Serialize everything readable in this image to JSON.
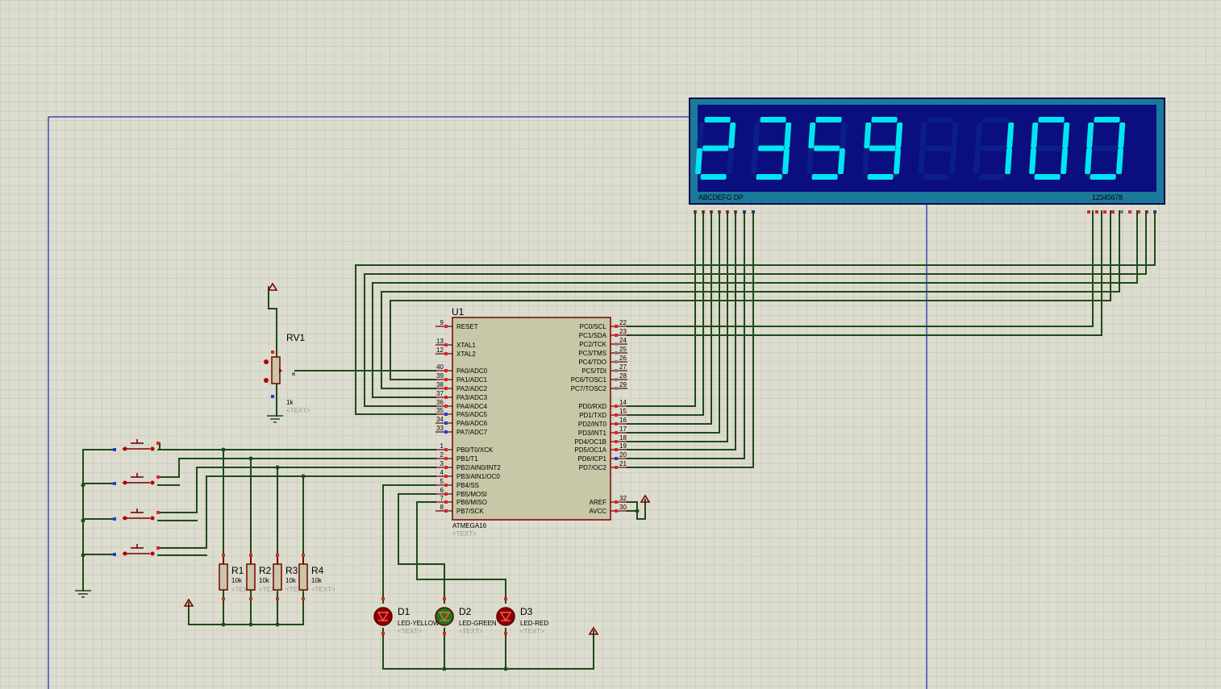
{
  "display": {
    "digits": [
      "2",
      "3",
      "5",
      "9",
      "8",
      "1",
      "0",
      "0"
    ],
    "lit": [
      true,
      true,
      true,
      true,
      false,
      true,
      true,
      true
    ],
    "segment_label": "ABCDEFG DP",
    "digit_label": "12345678",
    "lit_color": "#00e5f2",
    "dim_color": "#0a1d8a",
    "bg_color": "#0b0e7e",
    "frame_color": "#1b7a9c"
  },
  "mcu": {
    "ref": "U1",
    "part": "ATMEGA16",
    "text": "<TEXT>",
    "left_pins": [
      {
        "num": "9",
        "name": "RESET"
      },
      {
        "num": "13",
        "name": "XTAL1"
      },
      {
        "num": "12",
        "name": "XTAL2"
      },
      {
        "num": "40",
        "name": "PA0/ADC0"
      },
      {
        "num": "39",
        "name": "PA1/ADC1"
      },
      {
        "num": "38",
        "name": "PA2/ADC2"
      },
      {
        "num": "37",
        "name": "PA3/ADC3"
      },
      {
        "num": "36",
        "name": "PA4/ADC4"
      },
      {
        "num": "35",
        "name": "PA5/ADC5"
      },
      {
        "num": "34",
        "name": "PA6/ADC6"
      },
      {
        "num": "33",
        "name": "PA7/ADC7"
      },
      {
        "num": "1",
        "name": "PB0/T0/XCK"
      },
      {
        "num": "2",
        "name": "PB1/T1"
      },
      {
        "num": "3",
        "name": "PB2/AIN0/INT2"
      },
      {
        "num": "4",
        "name": "PB3/AIN1/OC0"
      },
      {
        "num": "5",
        "name": "PB4/SS"
      },
      {
        "num": "6",
        "name": "PB5/MOSI"
      },
      {
        "num": "7",
        "name": "PB6/MISO"
      },
      {
        "num": "8",
        "name": "PB7/SCK"
      }
    ],
    "right_pins": [
      {
        "num": "22",
        "name": "PC0/SCL"
      },
      {
        "num": "23",
        "name": "PC1/SDA"
      },
      {
        "num": "24",
        "name": "PC2/TCK"
      },
      {
        "num": "25",
        "name": "PC3/TMS"
      },
      {
        "num": "26",
        "name": "PC4/TDO"
      },
      {
        "num": "27",
        "name": "PC5/TDI"
      },
      {
        "num": "28",
        "name": "PC6/TOSC1"
      },
      {
        "num": "29",
        "name": "PC7/TOSC2"
      },
      {
        "num": "14",
        "name": "PD0/RXD"
      },
      {
        "num": "15",
        "name": "PD1/TXD"
      },
      {
        "num": "16",
        "name": "PD2/INT0"
      },
      {
        "num": "17",
        "name": "PD3/INT1"
      },
      {
        "num": "18",
        "name": "PD4/OC1B"
      },
      {
        "num": "19",
        "name": "PD5/OC1A"
      },
      {
        "num": "20",
        "name": "PD6/ICP1"
      },
      {
        "num": "21",
        "name": "PD7/OC2"
      },
      {
        "num": "32",
        "name": "AREF"
      },
      {
        "num": "30",
        "name": "AVCC"
      }
    ]
  },
  "pot": {
    "ref": "RV1",
    "value": "1k",
    "text": "<TEXT>"
  },
  "resistors": [
    {
      "ref": "R1",
      "value": "10k",
      "text": "<TEXT>"
    },
    {
      "ref": "R2",
      "value": "10k",
      "text": "<TEXT>"
    },
    {
      "ref": "R3",
      "value": "10k",
      "text": "<TEXT>"
    },
    {
      "ref": "R4",
      "value": "10k",
      "text": "<TEXT>"
    }
  ],
  "leds": [
    {
      "ref": "D1",
      "value": "LED-YELLOW",
      "text": "<TEXT>",
      "body": "#8a0000"
    },
    {
      "ref": "D2",
      "value": "LED-GREEN",
      "text": "<TEXT>",
      "body": "#1b7a14"
    },
    {
      "ref": "D3",
      "value": "LED-RED",
      "text": "<TEXT>",
      "body": "#8a0000"
    }
  ],
  "colors": {
    "wire": "#1e4a16",
    "component": "#7a0000",
    "sheet_border": "#1a2cb4",
    "background": "#dcdccf"
  }
}
